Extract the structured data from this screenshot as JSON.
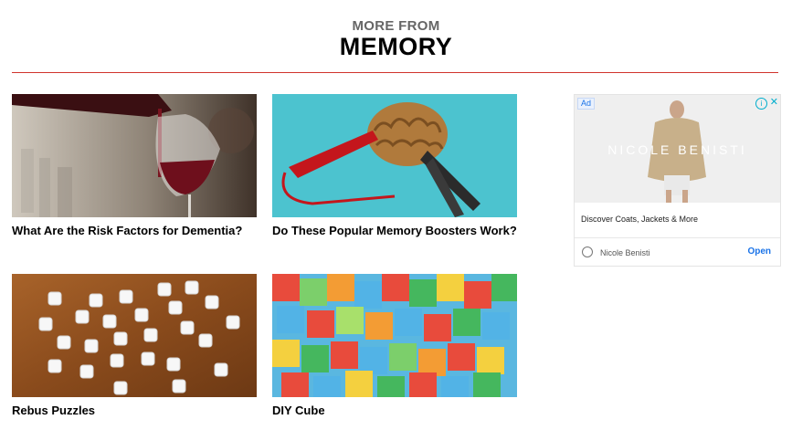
{
  "section": {
    "kicker": "MORE FROM",
    "title": "MEMORY"
  },
  "cards": [
    {
      "title": "What Are the Risk Factors for Dementia?",
      "image": "wine-pouring-photo"
    },
    {
      "title": "Do These Popular Memory Boosters Work?",
      "image": "brain-with-jumper-cables-photo"
    },
    {
      "title": "Rebus Puzzles",
      "image": "letter-beads-photo"
    },
    {
      "title": "DIY Cube",
      "image": "colorful-paper-cubes-photo"
    }
  ],
  "ad": {
    "badge": "Ad",
    "info_icon": "info-icon",
    "close_icon": "close-icon",
    "brand_banner": "NICOLE BENISTI",
    "headline": "Discover Coats, Jackets & More",
    "advertiser": "Nicole Benisti",
    "cta": "Open"
  },
  "colors": {
    "accent_rule": "#d0342c",
    "ad_link": "#1a73e8"
  }
}
